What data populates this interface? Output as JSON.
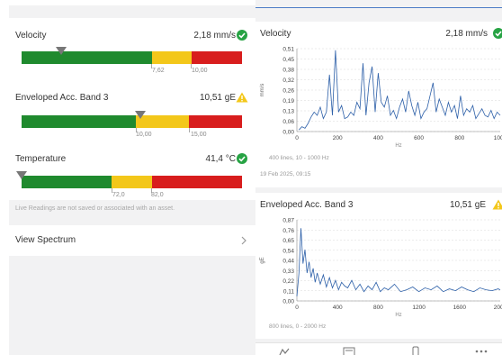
{
  "colors": {
    "green": "#1f8a2e",
    "yellow": "#f3c71a",
    "red": "#d81d1d",
    "ok": "#27a344",
    "warn": "#f3c71a",
    "line": "#2c5fa8"
  },
  "live": {
    "rows": [
      {
        "title": "Velocity",
        "value": "2,18 mm/s",
        "status": "check-icon",
        "fraction": 0.18,
        "thresholds": [
          "7,62",
          "10,00"
        ]
      },
      {
        "title": "Enveloped Acc. Band 3",
        "value": "10,51 gE",
        "status": "warning-icon",
        "fraction": 0.54,
        "thresholds": [
          "10,00",
          "15,00"
        ]
      },
      {
        "title": "Temperature",
        "value": "41,4 °C",
        "status": "check-icon",
        "fraction": 0.0,
        "thresholds": [
          "72,0",
          "82,0"
        ]
      }
    ],
    "note": "Live Readings are not saved or associated with an asset.",
    "view_spectrum": "View Spectrum"
  },
  "spectra": [
    {
      "title": "Velocity",
      "value": "2,18 mm/s",
      "status": "check-icon",
      "ylabel": "mm/s",
      "xlabel": "Hz",
      "meta": "400 lines, 10 - 1000 Hz",
      "date": "19 Feb 2025, 09:15"
    },
    {
      "title": "Enveloped Acc. Band 3",
      "value": "10,51 gE",
      "status": "warning-icon",
      "ylabel": "gE",
      "xlabel": "Hz",
      "meta": "800 lines, 0 - 2000 Hz",
      "date": ""
    }
  ],
  "chart_data": [
    {
      "type": "line",
      "title": "Velocity",
      "xlabel": "Hz",
      "ylabel": "mm/s",
      "xlim": [
        0,
        1000
      ],
      "ylim": [
        0,
        0.51
      ],
      "xticks": [
        "0",
        "200",
        "400",
        "600",
        "800",
        "1000"
      ],
      "yticks": [
        "0,00",
        "0,06",
        "0,13",
        "0,19",
        "0,26",
        "0,32",
        "0,38",
        "0,45",
        "0,51"
      ],
      "x": [
        10,
        25,
        40,
        55,
        70,
        85,
        100,
        115,
        130,
        145,
        160,
        175,
        190,
        205,
        220,
        235,
        250,
        265,
        280,
        295,
        310,
        325,
        340,
        355,
        370,
        385,
        400,
        415,
        430,
        445,
        460,
        475,
        490,
        505,
        520,
        535,
        550,
        565,
        580,
        595,
        610,
        625,
        640,
        655,
        670,
        685,
        700,
        715,
        730,
        745,
        760,
        775,
        790,
        805,
        820,
        835,
        850,
        865,
        880,
        895,
        910,
        925,
        940,
        955,
        970,
        985,
        1000
      ],
      "y": [
        0.01,
        0.03,
        0.02,
        0.05,
        0.09,
        0.12,
        0.1,
        0.15,
        0.08,
        0.12,
        0.35,
        0.1,
        0.5,
        0.12,
        0.16,
        0.08,
        0.09,
        0.12,
        0.1,
        0.18,
        0.14,
        0.42,
        0.1,
        0.3,
        0.4,
        0.12,
        0.36,
        0.18,
        0.15,
        0.22,
        0.1,
        0.13,
        0.08,
        0.15,
        0.2,
        0.12,
        0.25,
        0.16,
        0.1,
        0.18,
        0.08,
        0.12,
        0.14,
        0.22,
        0.3,
        0.12,
        0.2,
        0.15,
        0.1,
        0.18,
        0.12,
        0.16,
        0.08,
        0.22,
        0.1,
        0.14,
        0.12,
        0.16,
        0.08,
        0.11,
        0.14,
        0.1,
        0.09,
        0.13,
        0.08,
        0.12,
        0.1
      ]
    },
    {
      "type": "line",
      "title": "Enveloped Acc. Band 3",
      "xlabel": "Hz",
      "ylabel": "gE",
      "xlim": [
        0,
        2000
      ],
      "ylim": [
        0,
        0.87
      ],
      "xticks": [
        "0",
        "400",
        "800",
        "1200",
        "1600",
        "2000"
      ],
      "yticks": [
        "0,00",
        "0,11",
        "0,22",
        "0,33",
        "0,44",
        "0,54",
        "0,65",
        "0,76",
        "0,87"
      ],
      "x": [
        0,
        20,
        40,
        60,
        80,
        100,
        120,
        140,
        160,
        180,
        200,
        230,
        260,
        290,
        320,
        350,
        380,
        410,
        440,
        470,
        500,
        540,
        580,
        620,
        660,
        700,
        740,
        780,
        820,
        860,
        900,
        960,
        1020,
        1080,
        1140,
        1200,
        1260,
        1320,
        1380,
        1440,
        1500,
        1560,
        1620,
        1680,
        1740,
        1800,
        1860,
        1920,
        1980,
        2000
      ],
      "y": [
        0.05,
        0.3,
        0.78,
        0.4,
        0.55,
        0.3,
        0.42,
        0.25,
        0.35,
        0.2,
        0.3,
        0.18,
        0.28,
        0.15,
        0.25,
        0.14,
        0.22,
        0.12,
        0.2,
        0.16,
        0.14,
        0.22,
        0.12,
        0.18,
        0.1,
        0.16,
        0.12,
        0.2,
        0.1,
        0.14,
        0.12,
        0.18,
        0.1,
        0.12,
        0.15,
        0.1,
        0.14,
        0.12,
        0.16,
        0.1,
        0.13,
        0.11,
        0.15,
        0.12,
        0.1,
        0.14,
        0.12,
        0.11,
        0.13,
        0.12
      ]
    }
  ],
  "bottom_tabs": [
    "chart-icon",
    "document-icon",
    "device-icon",
    "more-icon"
  ]
}
